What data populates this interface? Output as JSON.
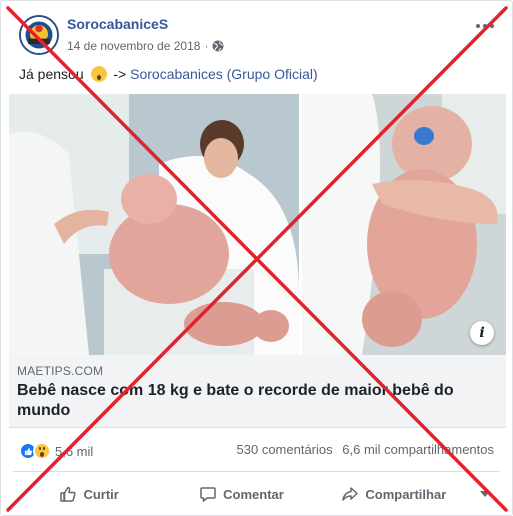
{
  "post": {
    "author": "SorocabaniceS",
    "date": "14 de novembro de 2018",
    "privacy_icon": "globe-icon",
    "text_before": "Já pensou",
    "text_emoji": "astonished-face-emoji",
    "text_arrow": "->",
    "text_link": "Sorocabanices (Grupo Oficial)"
  },
  "link_preview": {
    "domain": "MAETIPS.COM",
    "headline": "Bebê nasce com 18 kg e bate o recorde de maior bebê do mundo",
    "info_label": "i"
  },
  "stats": {
    "reactions": [
      "like",
      "wow"
    ],
    "reaction_count": "5,6 mil",
    "comments": "530 comentários",
    "shares": "6,6 mil compartilhamentos"
  },
  "actions": {
    "like_label": "Curtir",
    "comment_label": "Comentar",
    "share_label": "Compartilhar"
  },
  "colors": {
    "link_blue": "#385898",
    "like_blue": "#1877f2",
    "overlay_red": "#e0242d"
  }
}
